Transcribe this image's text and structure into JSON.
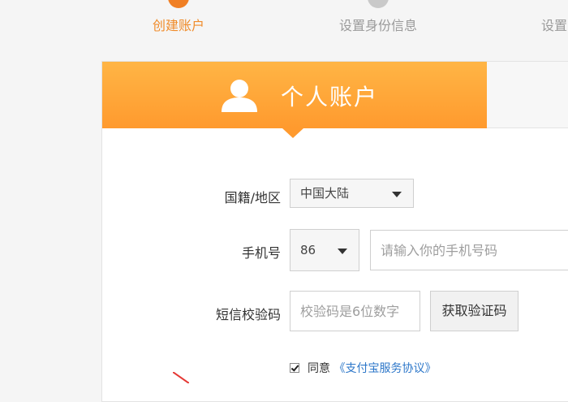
{
  "steps": [
    {
      "label": "创建账户",
      "active": true
    },
    {
      "label": "设置身份信息",
      "active": false
    },
    {
      "label": "设置",
      "active": false
    }
  ],
  "tabs": {
    "active_label": "个人账户",
    "inactive_label": ""
  },
  "form": {
    "nationality_label": "国籍/地区",
    "nationality_value": "中国大陆",
    "phone_label": "手机号",
    "country_code": "86",
    "phone_placeholder": "请输入你的手机号码",
    "sms_label": "短信校验码",
    "sms_placeholder": "校验码是6位数字",
    "get_code_button": "获取验证码",
    "agree_prefix": "同意",
    "agree_link": "《支付宝服务协议》"
  },
  "colors": {
    "accent": "#ff9a2e",
    "active_step": "#f08c2b",
    "link": "#2d77c9"
  }
}
